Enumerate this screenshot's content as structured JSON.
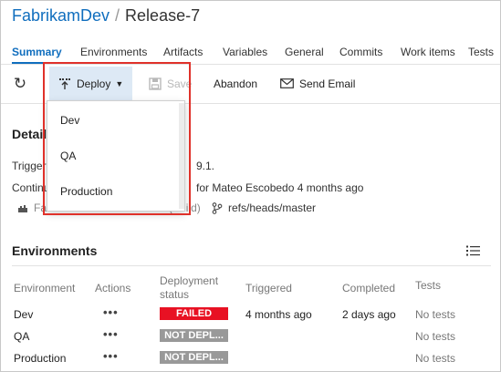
{
  "header": {
    "project": "FabrikamDev",
    "separator": "/",
    "release": "Release-7"
  },
  "tabs": [
    {
      "label": "Summary",
      "active": true
    },
    {
      "label": "Environments"
    },
    {
      "label": "Artifacts"
    },
    {
      "label": "Variables"
    },
    {
      "label": "General"
    },
    {
      "label": "Commits"
    },
    {
      "label": "Work items"
    },
    {
      "label": "Tests"
    }
  ],
  "toolbar": {
    "refresh_icon": "↻",
    "deploy_label": "Deploy",
    "save_label": "Save",
    "abandon_label": "Abandon",
    "send_email_label": "Send Email"
  },
  "deploy_menu": {
    "items": [
      "Dev",
      "QA",
      "Production"
    ]
  },
  "details": {
    "title": "Details",
    "trigger_prefix": "Trigger",
    "trigger_suffix": "9.1.",
    "continuous_prefix": "Continu",
    "continuous_suffix": "for Mateo Escobedo 4 months ago",
    "artifact_visible": "FabrikamDev / 20160915.7 (Build)",
    "branch": "refs/heads/master"
  },
  "environments": {
    "title": "Environments",
    "columns": [
      "Environment",
      "Actions",
      "Deployment status",
      "Triggered",
      "Completed",
      "Tests"
    ],
    "rows": [
      {
        "name": "Dev",
        "actions": "•••",
        "status": "FAILED",
        "triggered": "4 months ago",
        "completed": "2 days ago",
        "tests": "No tests"
      },
      {
        "name": "QA",
        "actions": "•••",
        "status": "NOT DEPL...",
        "triggered": "",
        "completed": "",
        "tests": "No tests"
      },
      {
        "name": "Production",
        "actions": "•••",
        "status": "NOT DEPL...",
        "triggered": "",
        "completed": "",
        "tests": "No tests"
      }
    ]
  },
  "colors": {
    "accent": "#106ebe",
    "failed": "#e81123",
    "not_deployed": "#999999",
    "highlight_border": "#e0312a",
    "deploy_bg": "#dde9f5"
  }
}
